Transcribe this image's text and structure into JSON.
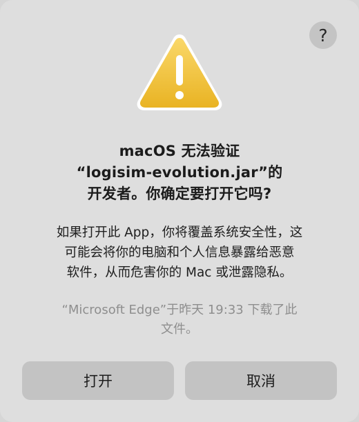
{
  "dialog": {
    "help_label": "?",
    "icon": "warning-triangle-icon",
    "title_lines": [
      "macOS 无法验证",
      "“logisim-evolution.jar”的",
      "开发者。你确定要打开它吗?"
    ],
    "message_lines": [
      "如果打开此 App，你将覆盖系统安全性，这",
      "可能会将你的电脑和个人信息暴露给恶意",
      "软件，从而危害你的 Mac 或泄露隐私。"
    ],
    "source_lines": [
      "“Microsoft Edge”于昨天 19:33 下载了此",
      "文件。"
    ],
    "buttons": {
      "open_label": "打开",
      "cancel_label": "取消"
    }
  },
  "colors": {
    "dialog_background": "#dedede",
    "button_background": "#c3c3c3",
    "warning_fill": "#f1c232",
    "secondary_text": "#8e8e8e"
  }
}
